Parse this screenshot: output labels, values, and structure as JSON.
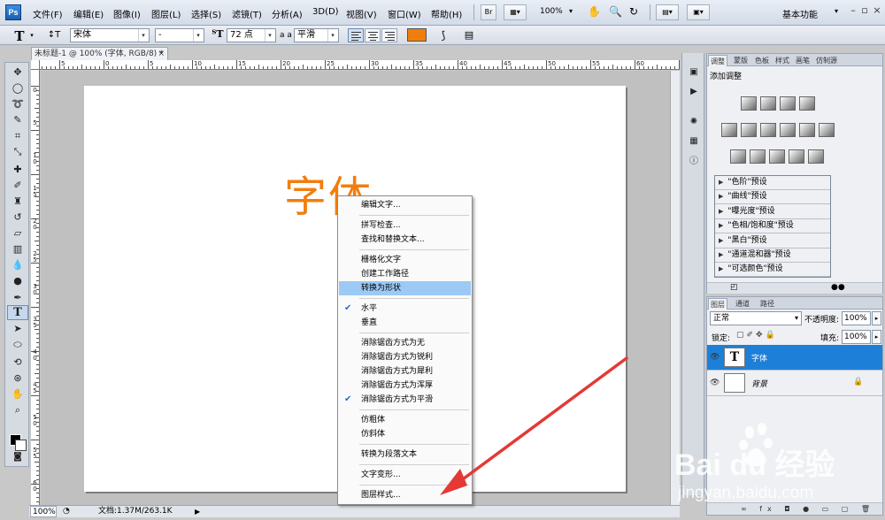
{
  "menubar": {
    "logo": "Ps",
    "items": [
      "文件(F)",
      "编辑(E)",
      "图像(I)",
      "图层(L)",
      "选择(S)",
      "滤镜(T)",
      "分析(A)",
      "3D(D)",
      "视图(V)",
      "窗口(W)",
      "帮助(H)"
    ],
    "bridge_label": "Br",
    "zoom": "100%",
    "workspace": "基本功能"
  },
  "options": {
    "font_family": "宋体",
    "font_style": "-",
    "font_size": "72 点",
    "aa_label": "a a",
    "antialias": "平滑",
    "text_color": "#f07e0f"
  },
  "document": {
    "tab_title": "未标题-1 @ 100% (字体, RGB/8) *",
    "canvas_text": "字体",
    "ruler_labels": [
      "5",
      "0",
      "5",
      "10",
      "15",
      "20",
      "25",
      "30",
      "35",
      "40",
      "45",
      "50",
      "55",
      "60",
      "65",
      "70",
      "75",
      "80",
      "85"
    ],
    "vruler_labels": [
      "0",
      "5",
      "1 0",
      "1 5",
      "2 0",
      "2 5",
      "3 0",
      "3 5",
      "4 0",
      "4 5",
      "5 0",
      "5 5",
      "6 0",
      "6 5"
    ],
    "status_zoom": "100%",
    "status_info": "文档:1.37M/263.1K"
  },
  "context_menu": {
    "items": [
      {
        "label": "编辑文字...",
        "checked": false,
        "highlight": false
      },
      {
        "sep": true
      },
      {
        "label": "拼写检查...",
        "checked": false,
        "highlight": false
      },
      {
        "label": "查找和替换文本...",
        "checked": false,
        "highlight": false
      },
      {
        "sep": true
      },
      {
        "label": "栅格化文字",
        "checked": false,
        "highlight": false
      },
      {
        "label": "创建工作路径",
        "checked": false,
        "highlight": false
      },
      {
        "label": "转换为形状",
        "checked": false,
        "highlight": true
      },
      {
        "sep": true
      },
      {
        "label": "水平",
        "checked": true,
        "highlight": false
      },
      {
        "label": "垂直",
        "checked": false,
        "highlight": false
      },
      {
        "sep": true
      },
      {
        "label": "消除锯齿方式为无",
        "checked": false,
        "highlight": false
      },
      {
        "label": "消除锯齿方式为锐利",
        "checked": false,
        "highlight": false
      },
      {
        "label": "消除锯齿方式为犀利",
        "checked": false,
        "highlight": false
      },
      {
        "label": "消除锯齿方式为浑厚",
        "checked": false,
        "highlight": false
      },
      {
        "label": "消除锯齿方式为平滑",
        "checked": true,
        "highlight": false
      },
      {
        "sep": true
      },
      {
        "label": "仿粗体",
        "checked": false,
        "highlight": false
      },
      {
        "label": "仿斜体",
        "checked": false,
        "highlight": false
      },
      {
        "sep": true
      },
      {
        "label": "转换为段落文本",
        "checked": false,
        "highlight": false
      },
      {
        "sep": true
      },
      {
        "label": "文字变形...",
        "checked": false,
        "highlight": false
      },
      {
        "sep": true
      },
      {
        "label": "图层样式...",
        "checked": false,
        "highlight": false
      }
    ]
  },
  "adjustments": {
    "tabs": [
      "调整",
      "蒙版",
      "色板",
      "样式",
      "画笔",
      "仿制源"
    ],
    "title": "添加调整",
    "presets": [
      "\"色阶\"预设",
      "\"曲线\"预设",
      "\"曝光度\"预设",
      "\"色相/饱和度\"预设",
      "\"黑白\"预设",
      "\"通道混和器\"预设",
      "\"可选颜色\"预设"
    ]
  },
  "layers": {
    "tabs": [
      "图层",
      "通道",
      "路径"
    ],
    "blend_mode": "正常",
    "opacity_label": "不透明度:",
    "opacity": "100%",
    "lock_label": "锁定:",
    "fill_label": "填充:",
    "fill": "100%",
    "items": [
      {
        "name": "字体",
        "thumb": "T",
        "selected": true
      },
      {
        "name": "背景",
        "thumb": "",
        "selected": false
      }
    ],
    "footer_icons": "∞ fx ◘ ● ▭ ▢ 🗑"
  },
  "watermark": {
    "brand": "Bai du 经验",
    "url": "jingyan.baidu.com"
  },
  "colors": {
    "accent_orange": "#f07e0f",
    "highlight_blue": "#9cc9f5",
    "selected_layer": "#1e7fd8",
    "arrow_red": "#e53935"
  }
}
